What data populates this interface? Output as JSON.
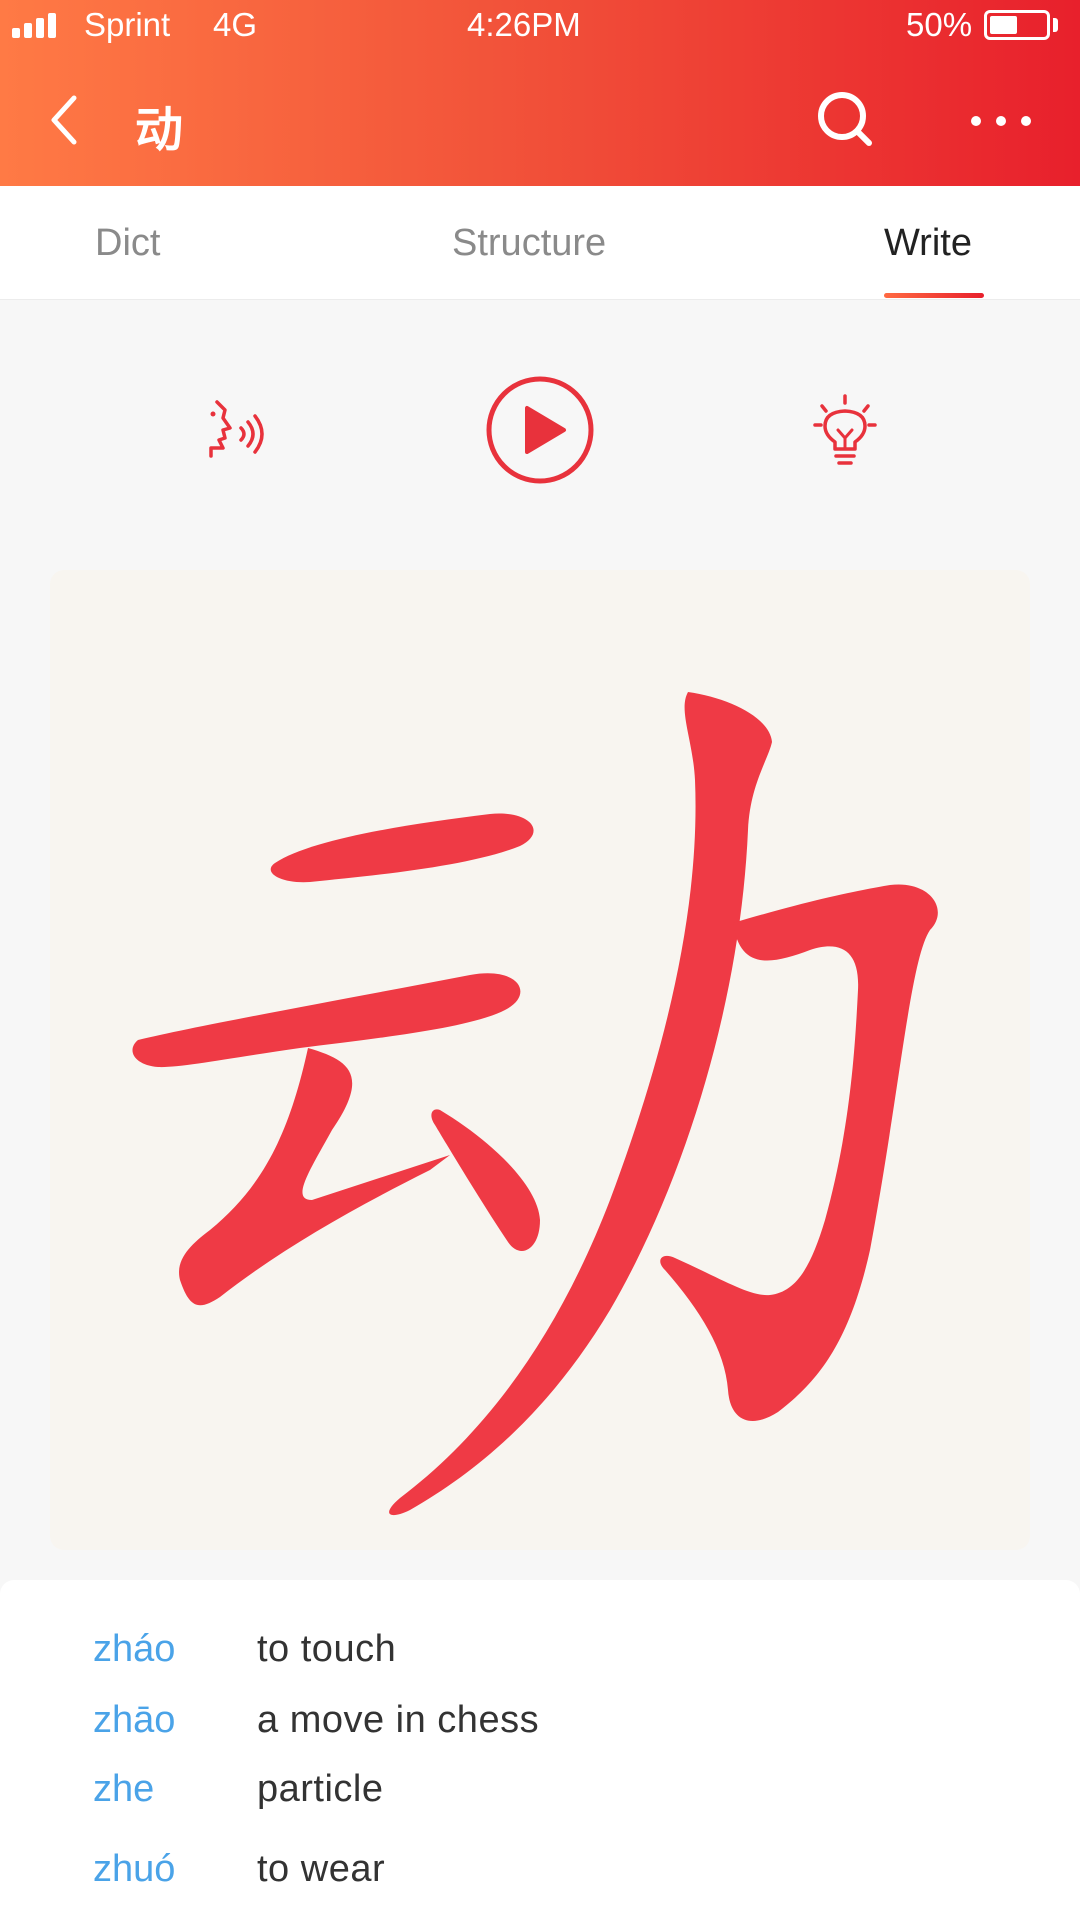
{
  "status_bar": {
    "carrier": "Sprint",
    "network": "4G",
    "time": "4:26PM",
    "battery_percent": "50%",
    "battery_level": 0.5,
    "signal_bars": 4
  },
  "nav": {
    "title": "动",
    "back_icon": "chevron-left-icon",
    "search_icon": "search-icon",
    "more_icon": "more-dots-icon"
  },
  "tabs": [
    {
      "label": "Dict",
      "active": false
    },
    {
      "label": "Structure",
      "active": false
    },
    {
      "label": "Write",
      "active": true
    }
  ],
  "tools": {
    "pronounce_icon": "speaking-head-icon",
    "play_icon": "play-circle-icon",
    "hint_icon": "lightbulb-icon"
  },
  "character": {
    "glyph": "动",
    "stroke_color": "#ef3a45",
    "canvas_color": "#f8f5f0"
  },
  "meanings": [
    {
      "pinyin": "zháo",
      "gloss": "to touch"
    },
    {
      "pinyin": "zhāo",
      "gloss": "a move in chess"
    },
    {
      "pinyin": "zhe",
      "gloss": "particle"
    },
    {
      "pinyin": "zhuó",
      "gloss": "to wear"
    }
  ],
  "colors": {
    "header_start": "#ff7a45",
    "header_end": "#e8202c",
    "accent": "#e8202c",
    "pinyin": "#4aa3e8"
  }
}
